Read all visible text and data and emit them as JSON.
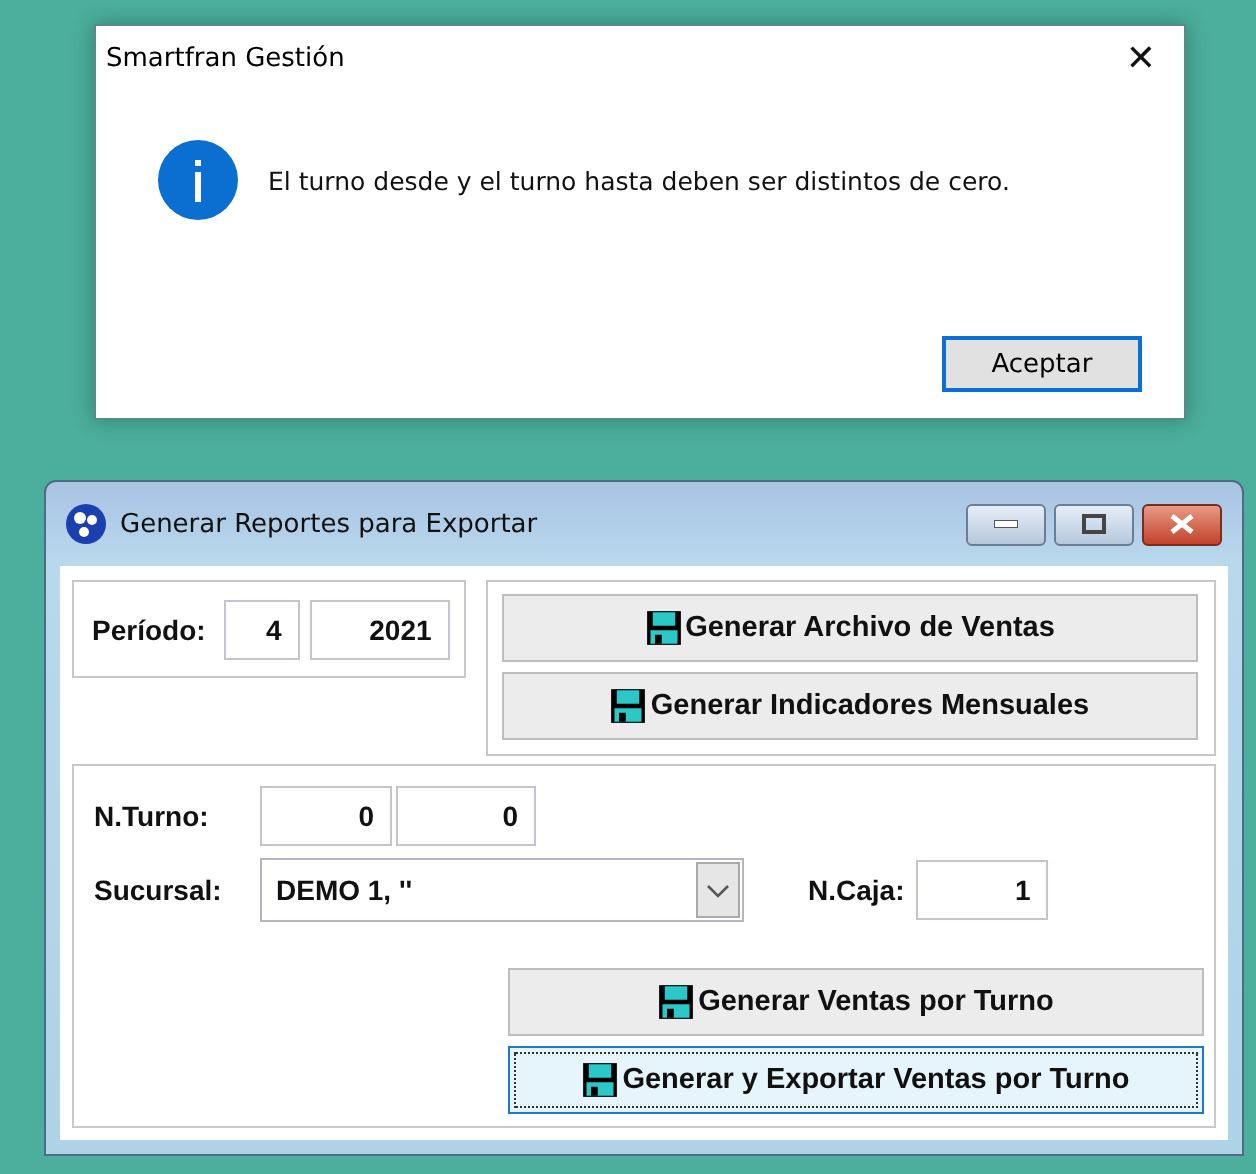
{
  "dialog": {
    "title": "Smartfran Gestión",
    "close": "✕",
    "message": "El turno desde y el turno hasta deben ser distintos de cero.",
    "button": {
      "label": "Aceptar",
      "focused": true
    }
  },
  "window": {
    "title": "Generar Reportes para Exportar"
  },
  "period": {
    "label": "Período:",
    "month": "4",
    "year": "2021"
  },
  "top_buttons": [
    {
      "label": "Generar Archivo de Ventas",
      "focused": false
    },
    {
      "label": "Generar Indicadores Mensuales",
      "focused": false
    }
  ],
  "turno": {
    "label": "N.Turno:",
    "from": "0",
    "to": "0"
  },
  "sucursal": {
    "label": "Sucursal:",
    "value": "DEMO 1, ''"
  },
  "caja": {
    "label": "N.Caja:",
    "value": "1"
  },
  "bottom_buttons": [
    {
      "label": "Generar Ventas por Turno",
      "focused": false
    },
    {
      "label": "Generar y Exportar Ventas por Turno",
      "focused": true
    }
  ]
}
